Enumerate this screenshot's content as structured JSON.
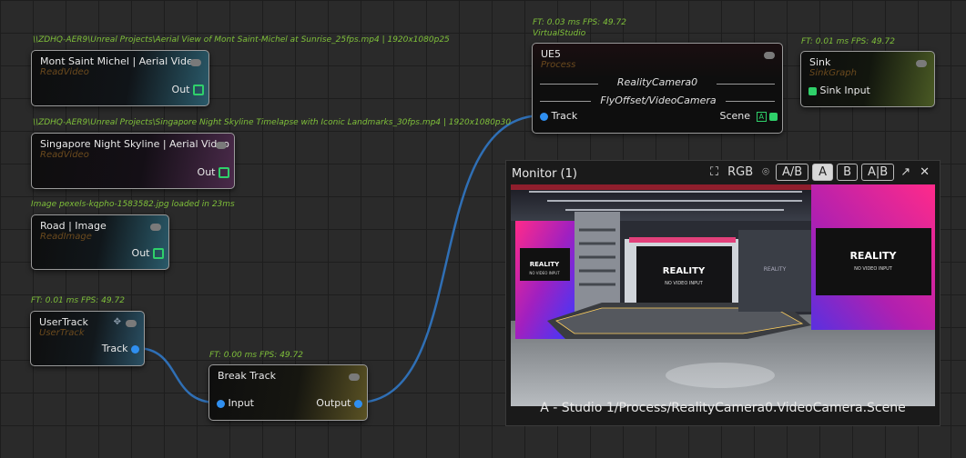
{
  "annotations": {
    "mont_path": "\\\\ZDHQ-AER9\\Unreal Projects\\Aerial View of Mont Saint-Michel at Sunrise_25fps.mp4 | 1920x1080p25",
    "singapore_path": "\\\\ZDHQ-AER9\\Unreal Projects\\Singapore Night Skyline Timelapse with Iconic Landmarks_30fps.mp4 | 1920x1080p30",
    "road_loaded": "Image pexels-kqpho-1583582.jpg loaded in 23ms",
    "usertrack_stats": "FT: 0.01 ms FPS: 49.72",
    "breaktrack_stats": "FT: 0.00 ms FPS: 49.72",
    "ue5_stats": "FT: 0.03 ms FPS: 49.72",
    "ue5_group": "VirtualStudio",
    "sink_stats": "FT: 0.01 ms FPS: 49.72"
  },
  "nodes": {
    "mont": {
      "title": "Mont Saint Michel | Aerial Video",
      "type": "ReadVideo",
      "out": "Out"
    },
    "singapore": {
      "title": "Singapore Night Skyline | Aerial Video",
      "type": "ReadVideo",
      "out": "Out"
    },
    "road": {
      "title": "Road | Image",
      "type": "ReadImage",
      "out": "Out"
    },
    "usertrack": {
      "title": "UserTrack",
      "type": "UserTrack",
      "out": "Track"
    },
    "breaktrack": {
      "title": "Break Track",
      "in": "Input",
      "out": "Output"
    },
    "ue5": {
      "title": "UE5",
      "type": "Process",
      "label1": "RealityCamera0",
      "label2": "FlyOffset/VideoCamera",
      "in": "Track",
      "out": "Scene",
      "badge": "A"
    },
    "sink": {
      "title": "Sink",
      "type": "SinkGraph",
      "in": "Sink Input"
    }
  },
  "monitor": {
    "title": "Monitor (1)",
    "rgb": "RGB",
    "ab": "A/B",
    "a": "A",
    "b": "B",
    "a_b": "A|B",
    "caption": "A - Studio 1/Process/RealityCamera0.VideoCamera.Scene",
    "screen_left_brand": "REALITY",
    "screen_left_sub": "NO VIDEO INPUT",
    "screen_center_brand": "REALITY",
    "screen_center_sub": "NO VIDEO INPUT",
    "screen_right_brand": "REALITY",
    "screen_right_sub": "NO VIDEO INPUT",
    "screen_far_brand": "REALITY"
  },
  "colors": {
    "annotation": "#7fc03a",
    "track_wire": "#2f6fb5",
    "track_pin": "#2f8ff0",
    "scene_pin": "#2fd06a",
    "readvideo_type": "#6b4a1e",
    "process_type": "#6b4a1e",
    "sinkgraph_type": "#6b4a1e"
  }
}
